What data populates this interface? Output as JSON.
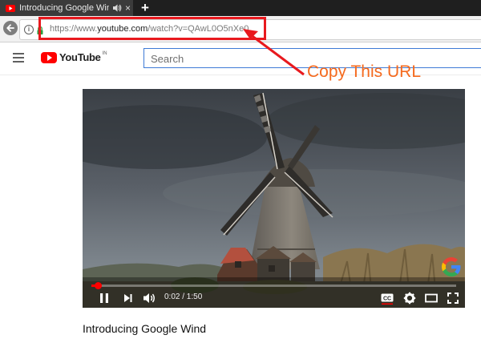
{
  "browser": {
    "tab": {
      "title": "Introducing Google Wind",
      "close_glyph": "×"
    },
    "new_tab_glyph": "+",
    "url": {
      "prefix": "https://www.",
      "host": "youtube.com",
      "path": "/watch?v=QAwL0O5nXe0"
    },
    "info_glyph": "i"
  },
  "annotation": {
    "label": "Copy This URL",
    "color": "#e8191e",
    "label_color": "#f56a1e"
  },
  "youtube": {
    "logo_text": "YouTube",
    "country_code": "IN",
    "search_placeholder": "Search"
  },
  "player": {
    "time_display": "0:02 / 1:50",
    "progress_fraction": 0.018,
    "buttons": [
      "play-pause",
      "next",
      "volume",
      "captions",
      "settings",
      "theater-mode",
      "fullscreen"
    ]
  },
  "video": {
    "title": "Introducing Google Wind"
  },
  "colors": {
    "youtube_red": "#ff0000",
    "search_focus": "#3e7ad6",
    "chrome_dark": "#1f1f1f"
  }
}
